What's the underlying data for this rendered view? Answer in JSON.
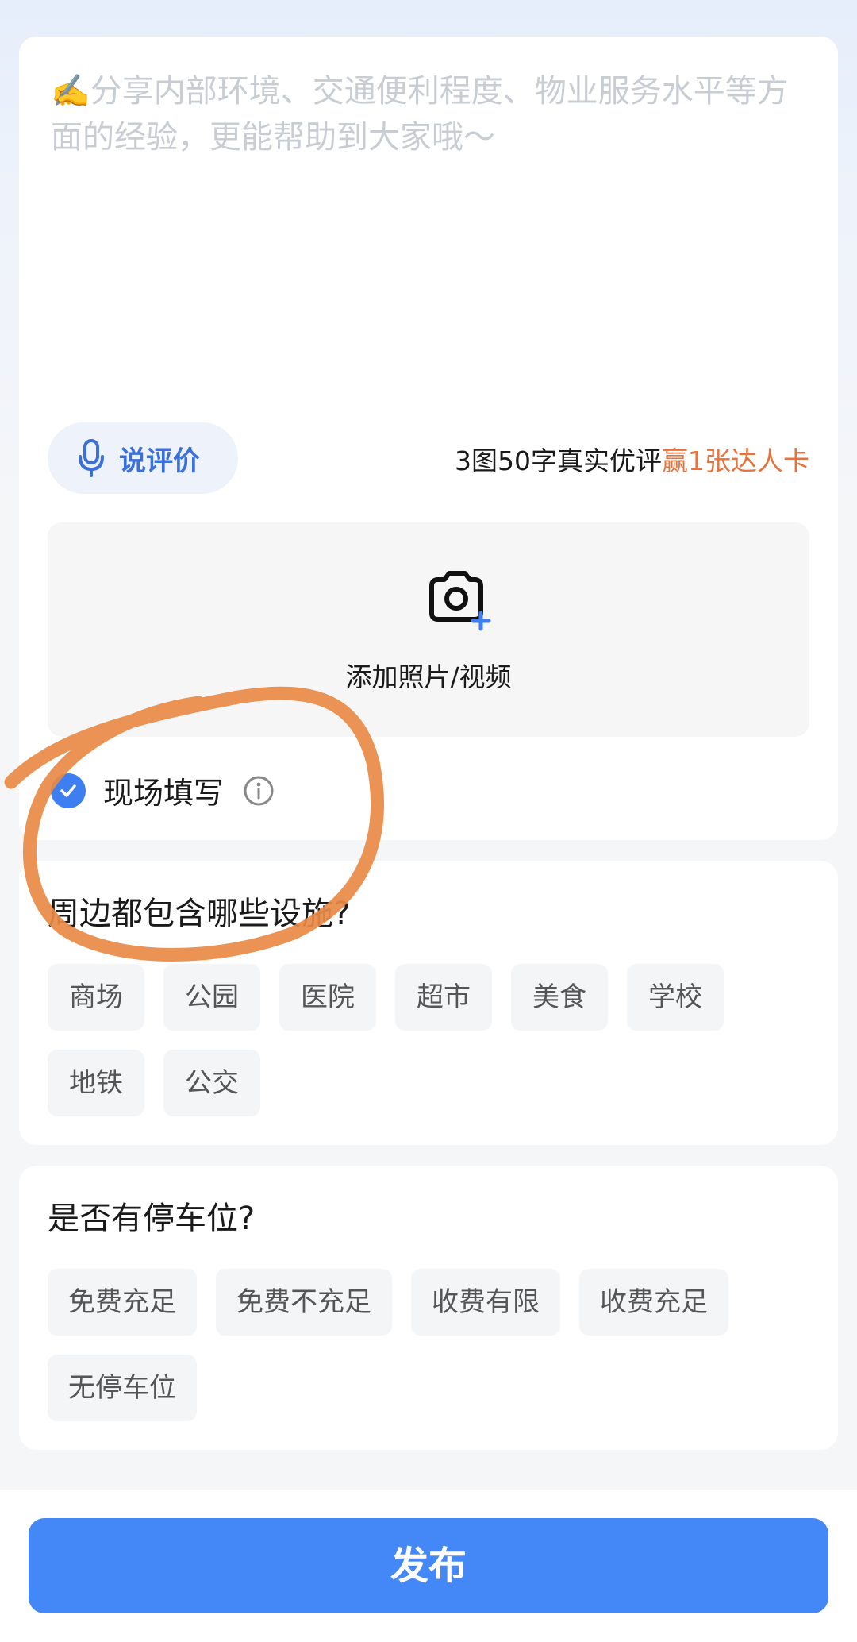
{
  "review": {
    "placeholder": "✍️分享内部环境、交通便利程度、物业服务水平等方面的经验，更能帮助到大家哦～",
    "voice_label": "说评价",
    "promo_prefix": "3图50字真实优评",
    "promo_highlight": "赢1张达人卡",
    "upload_label": "添加照片/视频",
    "onsite_label": "现场填写",
    "onsite_checked": true
  },
  "facilities": {
    "question": "周边都包含哪些设施?",
    "options": [
      "商场",
      "公园",
      "医院",
      "超市",
      "美食",
      "学校",
      "地铁",
      "公交"
    ]
  },
  "parking": {
    "question": "是否有停车位?",
    "options": [
      "免费充足",
      "免费不充足",
      "收费有限",
      "收费充足",
      "无停车位"
    ]
  },
  "footer": {
    "publish_label": "发布"
  },
  "colors": {
    "accent": "#4388f6",
    "highlight": "#e8723a",
    "annotation": "#e88a45"
  },
  "icons": {
    "voice": "microphone-icon",
    "upload": "camera-plus-icon",
    "check": "check-circle-icon",
    "info": "info-icon"
  }
}
